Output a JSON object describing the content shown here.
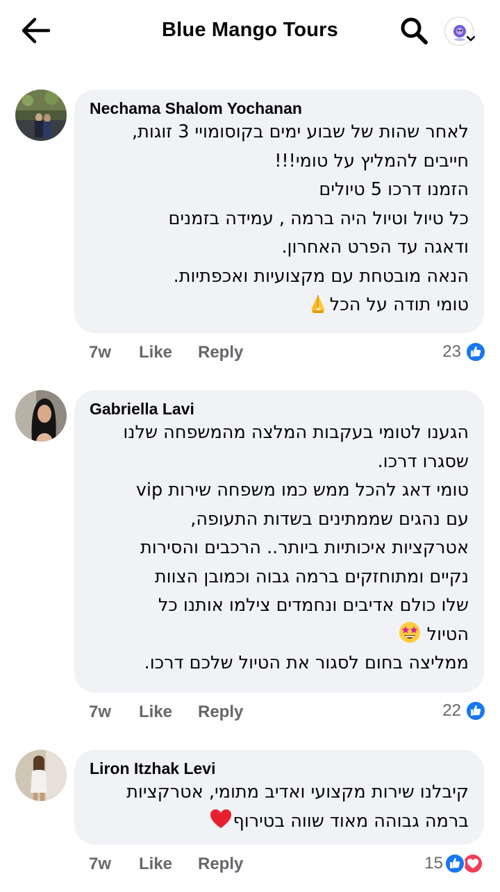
{
  "header": {
    "title": "Blue Mango Tours",
    "back_icon": "arrow-left-icon",
    "search_icon": "search-icon",
    "profile_icon": "profile-avatar-icon"
  },
  "comments": [
    {
      "author": "Nechama Shalom Yochanan",
      "lines": [
        "לאחר שהות של שבוע ימים בקוסומויי  3 זוגות,",
        "חייבים להמליץ על טומי!!!",
        "הזמנו דרכו 5 טיולים",
        "כל טיול וטיול היה ברמה , עמידה בזמנים",
        "ודאגה עד הפרט האחרון.",
        "הנאה מובטחת עם מקצועיות ואכפתיות.",
        "טומי תודה על הכל"
      ],
      "end_emoji": "folded-hands-emoji",
      "time": "7w",
      "like": "Like",
      "reply": "Reply",
      "reaction_count": "23",
      "reactions": [
        "like"
      ]
    },
    {
      "author": "Gabriella Lavi",
      "lines": [
        "הגענו לטומי בעקבות המלצה מהמשפחה שלנו",
        "שסגרו דרכו.",
        "טומי דאג להכל ממש כמו משפחה שירות vip",
        "עם נהגים שממתינים בשדות התעופה,",
        "אטרקציות איכותיות ביותר.. הרכבים והסירות",
        "נקיים ומתוחזקים ברמה גבוה וכמובן הצוות",
        "שלו כולם אדיבים ונחמדים צילמו אותנו כל",
        "הטיול",
        "ממליצה בחום לסגור את הטיול שלכם דרכו."
      ],
      "emoji_line_index": 7,
      "line_emoji": "star-struck-emoji",
      "time": "7w",
      "like": "Like",
      "reply": "Reply",
      "reaction_count": "22",
      "reactions": [
        "like"
      ]
    },
    {
      "author": "Liron Itzhak Levi",
      "lines": [
        "קיבלנו שירות מקצועי ואדיב מתומי, אטרקציות",
        "ברמה גבוהה מאוד שווה בטירוף"
      ],
      "end_emoji": "red-heart-emoji",
      "time": "7w",
      "like": "Like",
      "reply": "Reply",
      "reaction_count": "15",
      "reactions": [
        "like",
        "love"
      ]
    }
  ],
  "colors": {
    "bubble": "#f0f2f5",
    "secondary_text": "#65676b",
    "like_blue": "#1877f2",
    "love_red": "#f33e58"
  }
}
